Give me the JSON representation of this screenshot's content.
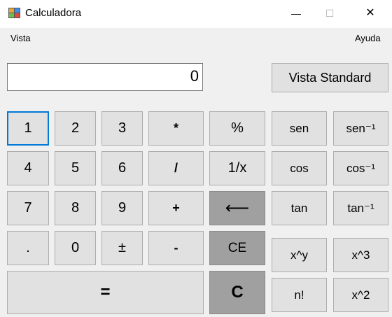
{
  "window": {
    "title": "Calculadora",
    "minimize": "—",
    "maximize": "☐",
    "close": "✕"
  },
  "menu": {
    "vista": "Vista",
    "ayuda": "Ayuda"
  },
  "display": {
    "value": "0"
  },
  "view_button": "Vista Standard",
  "keys": {
    "n1": "1",
    "n2": "2",
    "n3": "3",
    "n4": "4",
    "n5": "5",
    "n6": "6",
    "n7": "7",
    "n8": "8",
    "n9": "9",
    "n0": "0",
    "dot": ".",
    "plusminus": "±",
    "equals": "=",
    "mul": "*",
    "div": "/",
    "add": "+",
    "sub": "-",
    "percent": "%",
    "reciprocal": "1/x",
    "backspace": "⟵",
    "ce": "CE",
    "c": "C",
    "sen": "sen",
    "asen": "sen⁻¹",
    "cos": "cos",
    "acos": "cos⁻¹",
    "tan": "tan",
    "atan": "tan⁻¹",
    "pow": "x^y",
    "cube": "x^3",
    "fact": "n!",
    "square": "x^2"
  },
  "colors": {
    "button_bg": "#e1e1e1",
    "button_dark": "#a0a0a0",
    "focus_border": "#0078d7"
  }
}
